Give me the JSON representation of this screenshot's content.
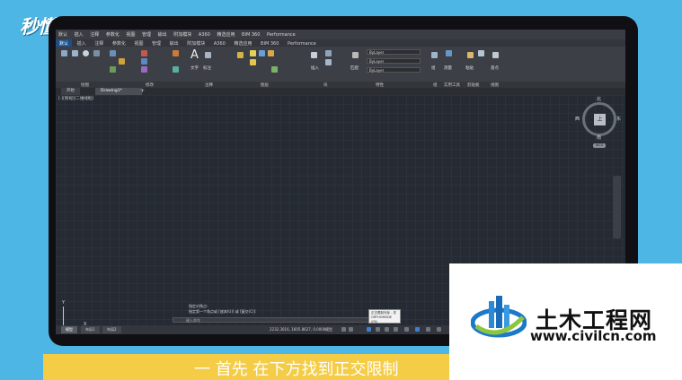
{
  "logo_text": "秒懂视频",
  "menu": {
    "items": [
      "默认",
      "插入",
      "注释",
      "参数化",
      "视图",
      "管理",
      "输出",
      "附加模块",
      "A360",
      "精选应用",
      "BIM 360",
      "Performance"
    ]
  },
  "tabbar": {
    "items": [
      "默认",
      "插入",
      "注释",
      "参数化",
      "视图",
      "管理",
      "输出",
      "附加模块",
      "A360",
      "精选应用",
      "BIM 360",
      "Performance"
    ]
  },
  "ribbon": {
    "panels": [
      "绘图",
      "修改",
      "注释",
      "图层",
      "块",
      "特性",
      "组",
      "实用工具",
      "剪贴板",
      "视图"
    ],
    "layer_combos": [
      "ByLayer",
      "ByLayer",
      "ByLayer"
    ],
    "labels": {
      "text": "文字",
      "mark": "标注",
      "insert": "插入",
      "match": "匹配",
      "group": "组",
      "measure": "测量",
      "paste": "粘贴",
      "base": "基点"
    }
  },
  "doc_tabs": [
    "开始",
    "Drawing1*"
  ],
  "viewport_label": "[-][俯视][二维线框]",
  "viewcube": {
    "north": "北",
    "south": "南",
    "east": "东",
    "west": "西",
    "face": "上",
    "wcs": "WCS"
  },
  "ucs": {
    "x": "X",
    "y": "Y"
  },
  "command": {
    "history": [
      "指定对角点:",
      "指定第一个角点或 [放弃(U)] 或 [窗交(C)]:"
    ],
    "placeholder": "键入命令"
  },
  "tooltip": {
    "line1": "正交限制光标 - 关",
    "line2": "ORTHOMODE (F8)"
  },
  "status": {
    "layout_tabs": [
      "模型",
      "布局1",
      "布局2"
    ],
    "coords": "2232.3016, 1605.8627, 0.0000",
    "mode": "模型"
  },
  "caption": "一 首先 在下方找到正交限制",
  "watermark": {
    "title": "土木工程网",
    "url": "www.civilcn.com"
  },
  "colors": {
    "background": "#4db6e4",
    "banner": "#f4cc46",
    "accent": "#3d7fd1",
    "canvas": "#252a33"
  }
}
